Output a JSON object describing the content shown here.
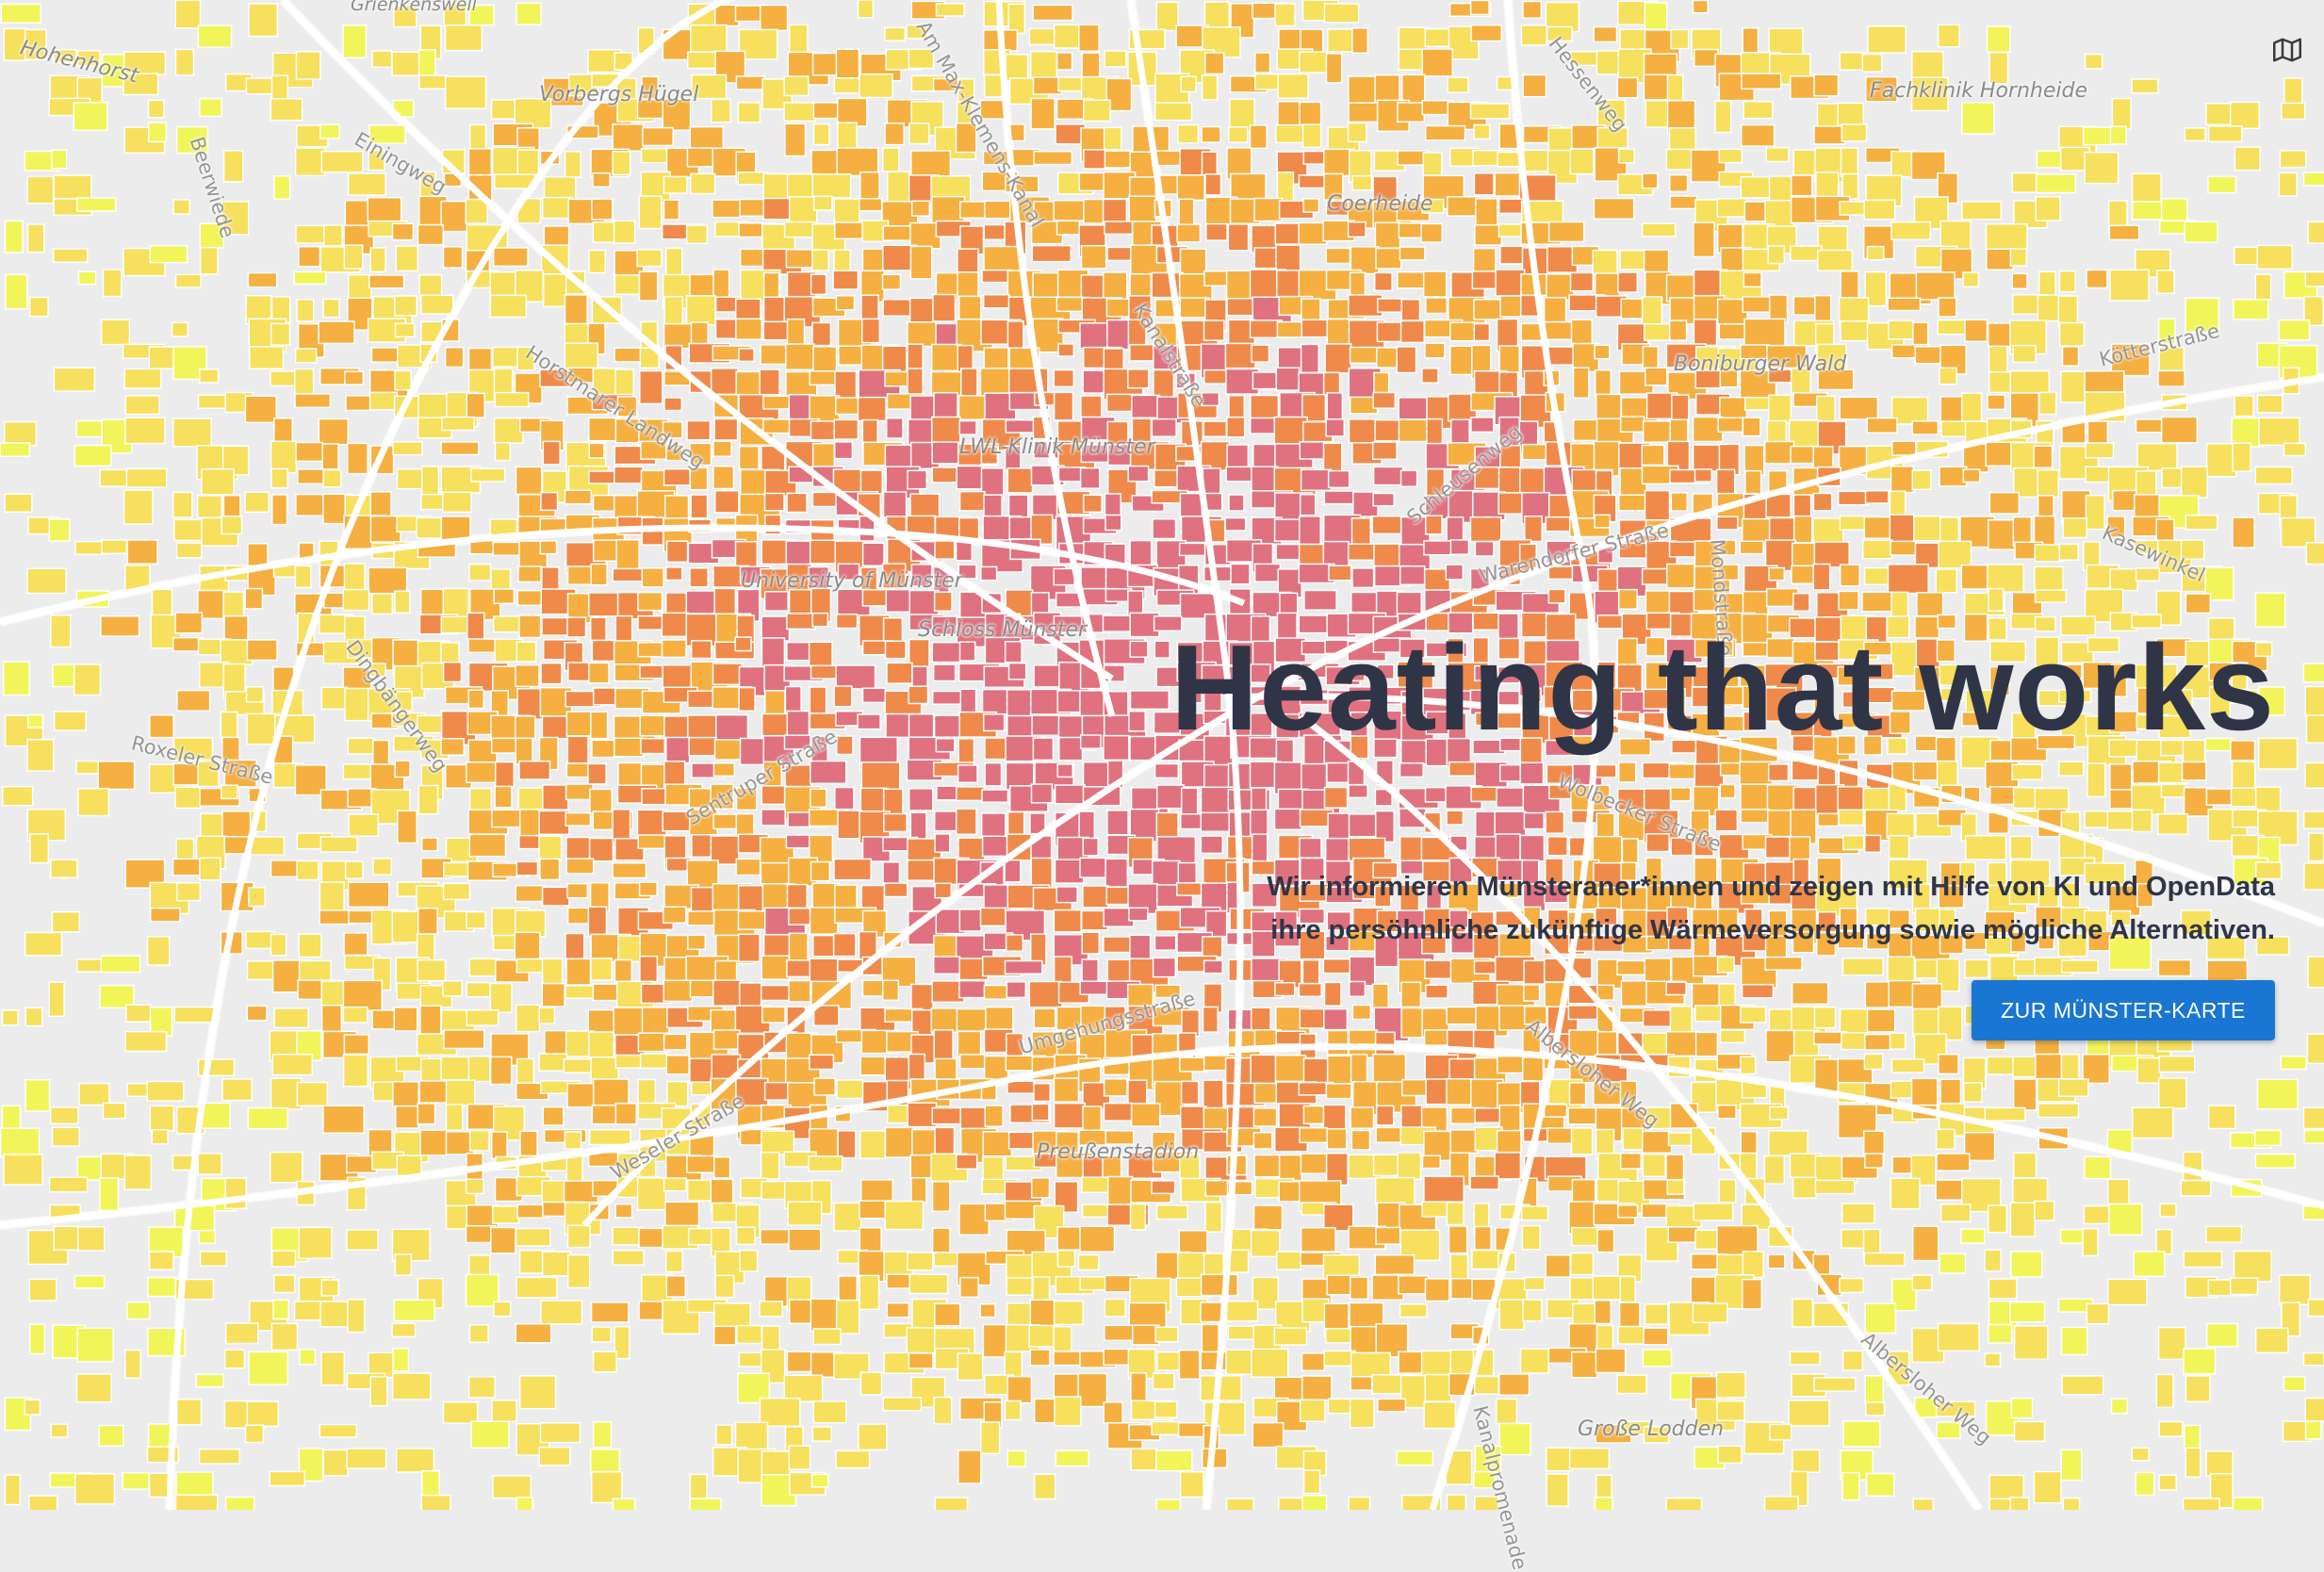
{
  "hero": {
    "title": "Heating that works",
    "text_line1": "Wir informieren Münsteraner*innen und zeigen mit Hilfe von KI und OpenData",
    "text_line2": "ihre persöhnliche zukünftige Wärmeversorgung sowie mögliche Alternativen.",
    "cta_label": "ZUR MÜNSTER-KARTE"
  },
  "map": {
    "toggle_icon": "map-icon",
    "place_labels": [
      "Vorbergs Hügel",
      "Coerheide",
      "Fachklinik Hornheide",
      "Boniburger Wald",
      "LWL-Klinik Münster",
      "University of Münster",
      "Schloss Münster",
      "Preußenstadion",
      "Große Lodden",
      "Hohenhorst",
      "Grienkenswell"
    ],
    "street_labels": [
      "Horstmarer Landweg",
      "Kanalstraße",
      "Warendorfer Straße",
      "Wolbecker Straße",
      "Umgehungsstraße",
      "Weseler Straße",
      "Albersloher Weg",
      "Albersloher Weg",
      "Roxeler Straße",
      "Sentruper Straße",
      "Schleusenweg",
      "Mondstraße",
      "Kasewinkel",
      "Kötterstraße",
      "Hessenweg",
      "Kanalpromenade",
      "Einingweg",
      "Beerwiede",
      "Dingbängerweg",
      "Am Max-Klemens-Kanal"
    ],
    "colors": {
      "background": "#ececec",
      "yellow": "#f6e05e",
      "light_yellow": "#f1f55a",
      "orange": "#f5b041",
      "dark_orange": "#f08a4b",
      "pink": "#e0727f"
    }
  }
}
